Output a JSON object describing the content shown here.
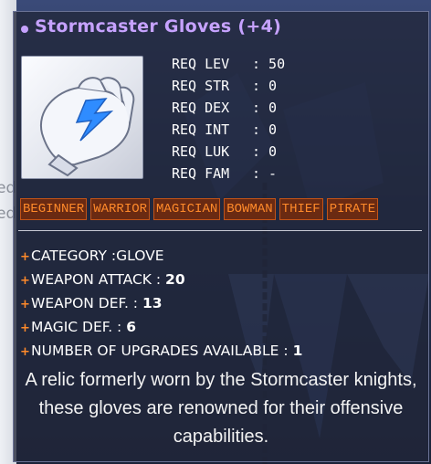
{
  "item": {
    "name": "Stormcaster Gloves (+4)",
    "icon": "gloves-icon",
    "requirements": [
      {
        "label": "REQ LEV",
        "value": ": 50"
      },
      {
        "label": "REQ STR",
        "value": ": 0"
      },
      {
        "label": "REQ DEX",
        "value": ": 0"
      },
      {
        "label": "REQ INT",
        "value": ": 0"
      },
      {
        "label": "REQ LUK",
        "value": ": 0"
      },
      {
        "label": "REQ FAM",
        "value": ": -"
      }
    ],
    "jobs": [
      "BEGINNER",
      "WARRIOR",
      "MAGICIAN",
      "BOWMAN",
      "THIEF",
      "PIRATE"
    ],
    "stats": [
      {
        "label": "CATEGORY :",
        "value": "GLOVE"
      },
      {
        "label": "WEAPON ATTACK : ",
        "value": "20"
      },
      {
        "label": "WEAPON DEF. : ",
        "value": "13"
      },
      {
        "label": "MAGIC DEF. : ",
        "value": "6"
      },
      {
        "label": "NUMBER OF UPGRADES AVAILABLE : ",
        "value": "1"
      }
    ],
    "description": "A relic formerly worn by the Stormcaster knights, these gloves are renowned for their offensive capabilities."
  },
  "background": {
    "partial_text": [
      "ed",
      "ed"
    ]
  },
  "colors": {
    "title": "#c6a2ff",
    "job_text": "#ff8a2a",
    "job_bg": "#6a2a12",
    "tooltip_bg": "#21263a"
  }
}
